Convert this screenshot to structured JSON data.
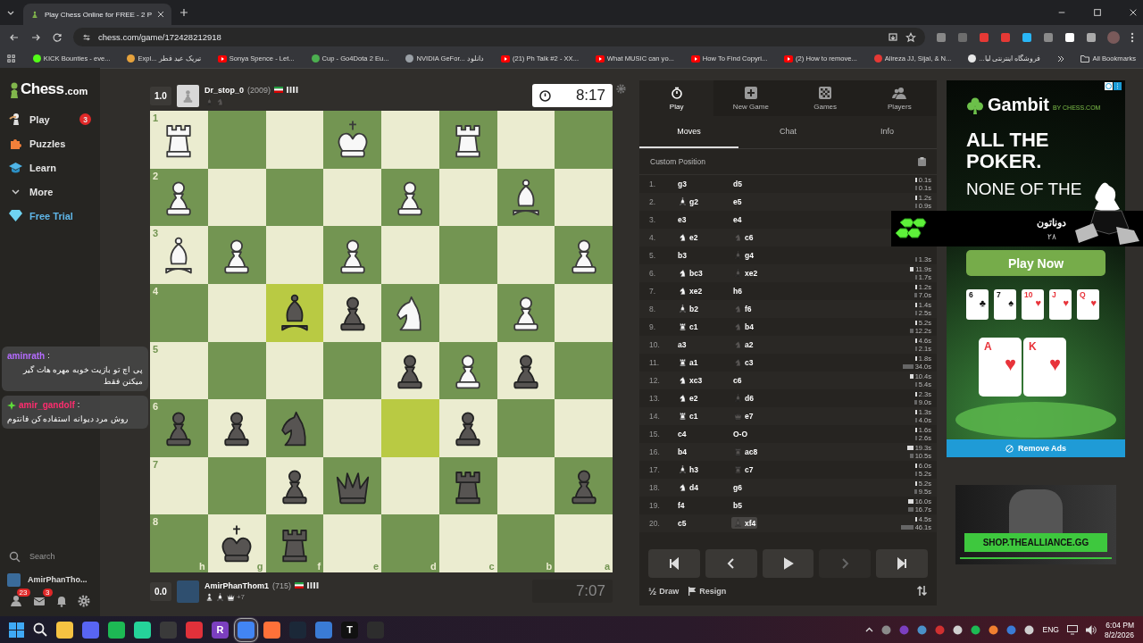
{
  "browser": {
    "tab_title": "Play Chess Online for FREE - 2 P",
    "url": "chess.com/game/172428212918",
    "bookmarks": [
      {
        "label": "KICK Bounties - eve...",
        "kind": "site",
        "color": "#53fc18"
      },
      {
        "label": "Expl... تبریک عید فطر",
        "kind": "site",
        "color": "#e6a23c"
      },
      {
        "label": "Sonya Spence - Let...",
        "kind": "video",
        "color": "#ff0000"
      },
      {
        "label": "Cup - Go4Dota 2 Eu...",
        "kind": "site",
        "color": "#4caf50"
      },
      {
        "label": "NVIDIA GeFor... دانلود",
        "kind": "site",
        "color": "#9aa0a6"
      },
      {
        "label": "(21) Ph Talk #2 - XX...",
        "kind": "video",
        "color": "#ff0000"
      },
      {
        "label": "What MUSIC can yo...",
        "kind": "video",
        "color": "#ff0000"
      },
      {
        "label": "How To Find Copyri...",
        "kind": "video",
        "color": "#ff0000"
      },
      {
        "label": "(2) How to remove...",
        "kind": "video",
        "color": "#ff0000"
      },
      {
        "label": "Alireza JJ, Sijal, & N...",
        "kind": "site",
        "color": "#e53935"
      },
      {
        "label": "فروشگاه اینترنتی لیا...",
        "kind": "site",
        "color": "#e8e8e8"
      }
    ],
    "all_bookmarks": "All Bookmarks"
  },
  "sidebar": {
    "logo_name": "Chess",
    "logo_suffix": ".com",
    "items": [
      {
        "label": "Play",
        "kind": "play",
        "badge": "3"
      },
      {
        "label": "Puzzles",
        "kind": "puzzles"
      },
      {
        "label": "Learn",
        "kind": "learn"
      },
      {
        "label": "More",
        "kind": "more"
      },
      {
        "label": "Free Trial",
        "kind": "trial"
      }
    ],
    "search": "Search",
    "username": "AmirPhanTho...",
    "footer_icons": [
      {
        "kind": "friends",
        "badge": "23"
      },
      {
        "kind": "messages",
        "badge": "3"
      },
      {
        "kind": "notifications"
      },
      {
        "kind": "settings"
      }
    ]
  },
  "top_player": {
    "score": "1.0",
    "name": "Dr_stop_0",
    "rating": "(2009)",
    "captured": [
      {
        "kind": "bishop"
      },
      {
        "kind": "knight"
      }
    ],
    "clock": "8:17",
    "clock_active": true
  },
  "bottom_player": {
    "score": "0.0",
    "name": "AmirPhanThom1",
    "rating": "(715)",
    "captured": [
      {
        "kind": "pawn"
      },
      {
        "kind": "bishop"
      },
      {
        "kind": "queen"
      }
    ],
    "advantage": "+7",
    "clock": "7:07",
    "clock_active": false
  },
  "board": {
    "files": [
      "h",
      "g",
      "f",
      "e",
      "d",
      "c",
      "b",
      "a"
    ],
    "ranks": [
      {
        "label": "1",
        "squares": [
          {
            "kind": "rook",
            "white": true,
            "highlighted": false
          },
          {
            "kind": "empty",
            "highlighted": false
          },
          {
            "kind": "empty",
            "highlighted": false
          },
          {
            "kind": "king",
            "white": true,
            "highlighted": false
          },
          {
            "kind": "empty",
            "highlighted": false
          },
          {
            "kind": "rook",
            "white": true,
            "highlighted": false
          },
          {
            "kind": "empty",
            "highlighted": false
          },
          {
            "kind": "empty",
            "highlighted": false
          }
        ]
      },
      {
        "label": "2",
        "squares": [
          {
            "kind": "pawn",
            "white": true,
            "highlighted": false
          },
          {
            "kind": "empty",
            "highlighted": false
          },
          {
            "kind": "empty",
            "highlighted": false
          },
          {
            "kind": "empty",
            "highlighted": false
          },
          {
            "kind": "pawn",
            "white": true,
            "highlighted": false
          },
          {
            "kind": "empty",
            "highlighted": false
          },
          {
            "kind": "bishop",
            "white": true,
            "highlighted": false
          },
          {
            "kind": "empty",
            "highlighted": false
          }
        ]
      },
      {
        "label": "3",
        "squares": [
          {
            "kind": "bishop",
            "white": true,
            "highlighted": false
          },
          {
            "kind": "pawn",
            "white": true,
            "highlighted": false
          },
          {
            "kind": "empty",
            "highlighted": false
          },
          {
            "kind": "pawn",
            "white": true,
            "highlighted": false
          },
          {
            "kind": "empty",
            "highlighted": false
          },
          {
            "kind": "empty",
            "highlighted": false
          },
          {
            "kind": "empty",
            "highlighted": false
          },
          {
            "kind": "pawn",
            "white": true,
            "highlighted": false
          }
        ]
      },
      {
        "label": "4",
        "squares": [
          {
            "kind": "empty",
            "highlighted": false
          },
          {
            "kind": "empty",
            "highlighted": false
          },
          {
            "kind": "bishop",
            "white": false,
            "highlighted": true
          },
          {
            "kind": "pawn",
            "white": false,
            "highlighted": false
          },
          {
            "kind": "knight",
            "white": true,
            "highlighted": false
          },
          {
            "kind": "empty",
            "highlighted": false
          },
          {
            "kind": "pawn",
            "white": true,
            "highlighted": false
          },
          {
            "kind": "empty",
            "highlighted": false
          }
        ]
      },
      {
        "label": "5",
        "squares": [
          {
            "kind": "empty",
            "highlighted": false
          },
          {
            "kind": "empty",
            "highlighted": false
          },
          {
            "kind": "empty",
            "highlighted": false
          },
          {
            "kind": "empty",
            "highlighted": false
          },
          {
            "kind": "pawn",
            "white": false,
            "highlighted": false
          },
          {
            "kind": "pawn",
            "white": true,
            "highlighted": false
          },
          {
            "kind": "pawn",
            "white": false,
            "highlighted": false
          },
          {
            "kind": "empty",
            "highlighted": false
          }
        ]
      },
      {
        "label": "6",
        "squares": [
          {
            "kind": "pawn",
            "white": false,
            "highlighted": false
          },
          {
            "kind": "pawn",
            "white": false,
            "highlighted": false
          },
          {
            "kind": "knight",
            "white": false,
            "highlighted": false
          },
          {
            "kind": "empty",
            "highlighted": false
          },
          {
            "kind": "empty",
            "highlighted": true
          },
          {
            "kind": "pawn",
            "white": false,
            "highlighted": false
          },
          {
            "kind": "empty",
            "highlighted": false
          },
          {
            "kind": "empty",
            "highlighted": false
          }
        ]
      },
      {
        "label": "7",
        "squares": [
          {
            "kind": "empty",
            "highlighted": false
          },
          {
            "kind": "empty",
            "highlighted": false
          },
          {
            "kind": "pawn",
            "white": false,
            "highlighted": false
          },
          {
            "kind": "queen",
            "white": false,
            "highlighted": false
          },
          {
            "kind": "empty",
            "highlighted": false
          },
          {
            "kind": "rook",
            "white": false,
            "highlighted": false
          },
          {
            "kind": "empty",
            "highlighted": false
          },
          {
            "kind": "pawn",
            "white": false,
            "highlighted": false
          }
        ]
      },
      {
        "label": "8",
        "squares": [
          {
            "kind": "empty",
            "highlighted": false
          },
          {
            "kind": "king",
            "white": false,
            "highlighted": false
          },
          {
            "kind": "rook",
            "white": false,
            "highlighted": false
          },
          {
            "kind": "empty",
            "highlighted": false
          },
          {
            "kind": "empty",
            "highlighted": false
          },
          {
            "kind": "empty",
            "highlighted": false
          },
          {
            "kind": "empty",
            "highlighted": false
          },
          {
            "kind": "empty",
            "highlighted": false
          }
        ]
      }
    ]
  },
  "panel": {
    "nav": [
      {
        "label": "Play",
        "kind": "stopwatch",
        "selected": true
      },
      {
        "label": "New Game",
        "kind": "plus",
        "selected": false
      },
      {
        "label": "Games",
        "kind": "board",
        "selected": false
      },
      {
        "label": "Players",
        "kind": "people",
        "selected": false
      }
    ],
    "tabs": [
      {
        "label": "Moves",
        "selected": true
      },
      {
        "label": "Chat",
        "selected": false
      },
      {
        "label": "Info",
        "selected": false
      }
    ],
    "header": "Custom Position",
    "moves": [
      {
        "number": "1.",
        "white": {
          "san": "g3",
          "selected": false
        },
        "black": {
          "san": "d5",
          "selected": false
        },
        "white_time": "0.1s",
        "black_time": "0.1s"
      },
      {
        "number": "2.",
        "white": {
          "kind": "bishop",
          "san": "g2",
          "selected": false
        },
        "black": {
          "san": "e5",
          "selected": false
        },
        "white_time": "1.2s",
        "black_time": "0.9s"
      },
      {
        "number": "3.",
        "white": {
          "san": "e3",
          "selected": false
        },
        "black": {
          "san": "e4",
          "selected": false
        }
      },
      {
        "number": "4.",
        "white": {
          "kind": "knight",
          "san": "e2",
          "selected": false
        },
        "black": {
          "kind": "knight",
          "san": "c6",
          "selected": false
        }
      },
      {
        "number": "5.",
        "white": {
          "san": "b3",
          "selected": false
        },
        "black": {
          "kind": "bishop",
          "san": "g4",
          "selected": false
        },
        "black_time": "1.3s"
      },
      {
        "number": "6.",
        "white": {
          "kind": "knight",
          "san": "bc3",
          "selected": false
        },
        "black": {
          "kind": "bishop",
          "san": "xe2",
          "selected": false
        },
        "white_time": "11.9s",
        "black_time": "1.7s"
      },
      {
        "number": "7.",
        "white": {
          "kind": "knight",
          "san": "xe2",
          "selected": false
        },
        "black": {
          "san": "h6",
          "selected": false
        },
        "white_time": "1.2s",
        "black_time": "7.0s"
      },
      {
        "number": "8.",
        "white": {
          "kind": "bishop",
          "san": "b2",
          "selected": false
        },
        "black": {
          "kind": "knight",
          "san": "f6",
          "selected": false
        },
        "white_time": "1.4s",
        "black_time": "2.5s"
      },
      {
        "number": "9.",
        "white": {
          "kind": "rook",
          "san": "c1",
          "selected": false
        },
        "black": {
          "kind": "knight",
          "san": "b4",
          "selected": false
        },
        "white_time": "5.2s",
        "black_time": "12.2s"
      },
      {
        "number": "10.",
        "white": {
          "san": "a3",
          "selected": false
        },
        "black": {
          "kind": "knight",
          "san": "a2",
          "selected": false
        },
        "white_time": "4.6s",
        "black_time": "2.1s"
      },
      {
        "number": "11.",
        "white": {
          "kind": "rook",
          "san": "a1",
          "selected": false
        },
        "black": {
          "kind": "knight",
          "san": "c3",
          "selected": false
        },
        "white_time": "1.8s",
        "black_time": "34.0s"
      },
      {
        "number": "12.",
        "white": {
          "kind": "knight",
          "san": "xc3",
          "selected": false
        },
        "black": {
          "san": "c6",
          "selected": false
        },
        "white_time": "10.4s",
        "black_time": "5.4s"
      },
      {
        "number": "13.",
        "white": {
          "kind": "knight",
          "san": "e2",
          "selected": false
        },
        "black": {
          "kind": "bishop",
          "san": "d6",
          "selected": false
        },
        "white_time": "2.3s",
        "black_time": "9.0s"
      },
      {
        "number": "14.",
        "white": {
          "kind": "rook",
          "san": "c1",
          "selected": false
        },
        "black": {
          "kind": "queen",
          "san": "e7",
          "selected": false
        },
        "white_time": "1.3s",
        "black_time": "4.0s"
      },
      {
        "number": "15.",
        "white": {
          "san": "c4",
          "selected": false
        },
        "black": {
          "san": "O-O",
          "selected": false
        },
        "white_time": "1.6s",
        "black_time": "2.6s"
      },
      {
        "number": "16.",
        "white": {
          "san": "b4",
          "selected": false
        },
        "black": {
          "kind": "rook",
          "san": "ac8",
          "selected": false
        },
        "white_time": "19.3s",
        "black_time": "10.5s"
      },
      {
        "number": "17.",
        "white": {
          "kind": "bishop",
          "san": "h3",
          "selected": false
        },
        "black": {
          "kind": "rook",
          "san": "c7",
          "selected": false
        },
        "white_time": "6.0s",
        "black_time": "5.2s"
      },
      {
        "number": "18.",
        "white": {
          "kind": "knight",
          "san": "d4",
          "selected": false
        },
        "black": {
          "san": "g6",
          "selected": false
        },
        "white_time": "5.2s",
        "black_time": "9.5s"
      },
      {
        "number": "19.",
        "white": {
          "san": "f4",
          "selected": false
        },
        "black": {
          "san": "b5",
          "selected": false
        },
        "white_time": "16.0s",
        "black_time": "16.7s"
      },
      {
        "number": "20.",
        "white": {
          "san": "c5",
          "selected": false
        },
        "black": {
          "kind": "bishop",
          "san": "xf4",
          "selected": true
        },
        "white_time": "4.5s",
        "black_time": "46.1s"
      }
    ],
    "controls": [
      {
        "kind": "first",
        "disabled": false
      },
      {
        "kind": "prev",
        "disabled": false
      },
      {
        "kind": "play",
        "disabled": false
      },
      {
        "kind": "next",
        "disabled": true
      },
      {
        "kind": "last",
        "disabled": false
      }
    ],
    "draw_glyph": "½",
    "draw": "Draw",
    "resign": "Resign"
  },
  "ad": {
    "brand": "Gambit",
    "by": "BY CHESS.COM",
    "headline": "ALL THE POKER.",
    "subhead": "NONE OF THE",
    "cta": "Play Now",
    "cards": [
      {
        "rank": "6",
        "suit": "♣",
        "color": "#111111"
      },
      {
        "rank": "7",
        "suit": "♠",
        "color": "#111111"
      },
      {
        "rank": "10",
        "suit": "♥",
        "color": "#e8333a"
      },
      {
        "rank": "J",
        "suit": "♥",
        "color": "#e8333a"
      },
      {
        "rank": "Q",
        "suit": "♥",
        "color": "#e8333a"
      }
    ],
    "hole_cards": [
      {
        "rank": "A",
        "suit": "♥",
        "color": "#e8333a"
      },
      {
        "rank": "K",
        "suit": "♥",
        "color": "#e8333a"
      }
    ],
    "remove": "Remove Ads",
    "shop": "SHOP.THEALLIANCE.GG"
  },
  "overlay": {
    "donation_title": "دوناتون",
    "donation_count": "۲۸",
    "chat": [
      {
        "user": "aminrath",
        "color": "#b56cff",
        "sep": ":",
        "text": "پی اچ تو بازیت خوبه مهره هات گیر میکنن فقط",
        "badge": false
      },
      {
        "user": "amir_gandolf",
        "color": "#ff2d6f",
        "sep": ":",
        "text": "روش مرد دیوانه استفاده کن فانتوم",
        "badge": true
      }
    ]
  },
  "taskbar": {
    "apps": [
      {
        "kind": "windows",
        "selected": false
      },
      {
        "kind": "search",
        "selected": false
      },
      {
        "kind": "app",
        "color": "#f5c242",
        "selected": false
      },
      {
        "kind": "app",
        "color": "#5865f2",
        "selected": false
      },
      {
        "kind": "app",
        "color": "#1db954",
        "selected": false
      },
      {
        "kind": "app",
        "color": "#25d39a",
        "selected": false
      },
      {
        "kind": "app",
        "color": "#3a3a3a",
        "selected": false
      },
      {
        "kind": "app",
        "color": "#e0313a",
        "selected": false
      },
      {
        "kind": "app",
        "color": "#7b3fbf",
        "glyph": "R",
        "selected": false
      },
      {
        "kind": "app",
        "color": "#4285f4",
        "selected": true
      },
      {
        "kind": "app",
        "color": "#ff7139",
        "selected": false
      },
      {
        "kind": "app",
        "color": "#1b2838",
        "selected": false
      },
      {
        "kind": "app",
        "color": "#3a7bd5",
        "selected": false
      },
      {
        "kind": "app",
        "color": "#111111",
        "glyph": "T",
        "selected": false
      },
      {
        "kind": "app",
        "color": "#2d2d2d",
        "selected": false
      }
    ],
    "tray": [
      {
        "color": "#8a8a8a"
      },
      {
        "color": "#7b3fbf"
      },
      {
        "color": "#4a90c8"
      },
      {
        "color": "#d03030"
      },
      {
        "color": "#cfcfcf"
      },
      {
        "color": "#1db954"
      },
      {
        "color": "#f08030"
      },
      {
        "color": "#3a7bd5"
      },
      {
        "color": "#cfcfcf"
      }
    ],
    "language": "ENG",
    "time": "6:04 PM",
    "date": "8/2/2026"
  }
}
